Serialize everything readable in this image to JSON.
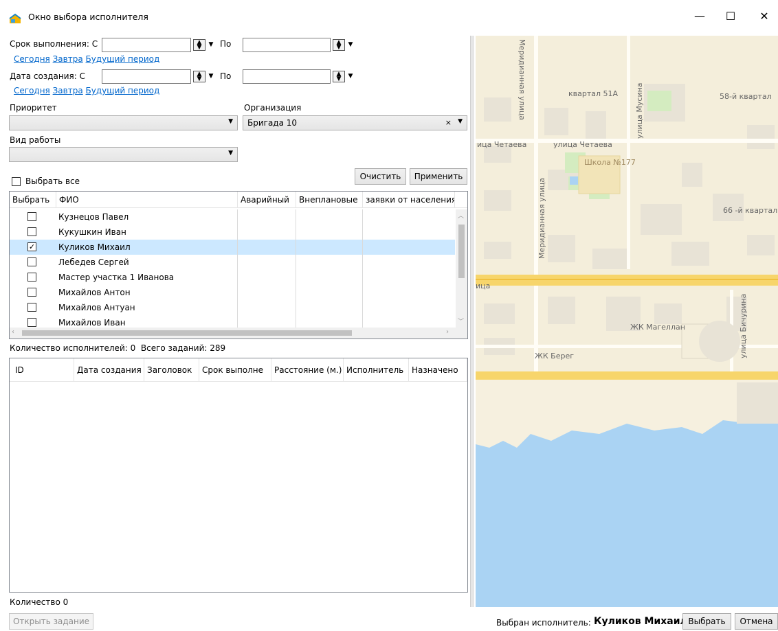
{
  "window": {
    "title": "Окно выбора исполнителя",
    "minimize": "—",
    "maximize": "☐",
    "close": "✕"
  },
  "filters": {
    "due_label": "Срок выполнения: С",
    "due_to_label": "По",
    "due_from_value": "",
    "due_to_value": "",
    "created_label": "Дата создания: С",
    "created_to_label": "По",
    "created_from_value": "",
    "created_to_value": "",
    "quick_links": [
      "Сегодня",
      "Завтра",
      "Будущий период"
    ],
    "priority_label": "Приоритет",
    "priority_value": "",
    "organization_label": "Организация",
    "organization_value": "Бригада 10",
    "worktype_label": "Вид работы",
    "worktype_value": "",
    "select_all_label": "Выбрать все",
    "clear_button": "Очистить",
    "apply_button": "Применить"
  },
  "performers": {
    "columns": [
      "Выбрать",
      "ФИО",
      "Аварийный",
      "Внеплановые",
      "заявки от населения"
    ],
    "rows": [
      {
        "name": "Кузнецов Павел",
        "checked": false,
        "selected": false
      },
      {
        "name": "Кукушкин Иван",
        "checked": false,
        "selected": false
      },
      {
        "name": "Куликов Михаил",
        "checked": true,
        "selected": true
      },
      {
        "name": "Лебедев Сергей",
        "checked": false,
        "selected": false
      },
      {
        "name": "Мастер участка 1 Иванова",
        "checked": false,
        "selected": false
      },
      {
        "name": "Михайлов Антон",
        "checked": false,
        "selected": false
      },
      {
        "name": "Михайлов Антуан",
        "checked": false,
        "selected": false
      },
      {
        "name": "Михайлов Иван",
        "checked": false,
        "selected": false
      }
    ],
    "summary": "Количество исполнителей: 0  Всего заданий: 289"
  },
  "tasks": {
    "columns": [
      "ID",
      "Дата создания",
      "Заголовок",
      "Срок выполне",
      "Расстояние (м.)",
      "Исполнитель",
      "Назначено"
    ],
    "count_label": "Количество 0",
    "open_button": "Открыть задание"
  },
  "map": {
    "labels": [
      "Меридианная улица",
      "квартал 51А",
      "улица Мусина",
      "58-й квартал",
      "ица Четаева",
      "улица Четаева",
      "Школа №177",
      "Меридианная улица",
      "66 -й квартал",
      "ица",
      "улица Бичурина",
      "ЖК Магеллан",
      "ЖК Берег"
    ]
  },
  "footer": {
    "selected_prefix": "Выбран исполнитель:",
    "selected_name": "Куликов Михаил",
    "choose_button": "Выбрать",
    "cancel_button": "Отмена"
  },
  "colors": {
    "link": "#0066cc",
    "row_selected": "#cce8ff",
    "map_bg": "#f6f0df",
    "map_road": "#f7d56b",
    "map_water": "#aad3f3"
  }
}
